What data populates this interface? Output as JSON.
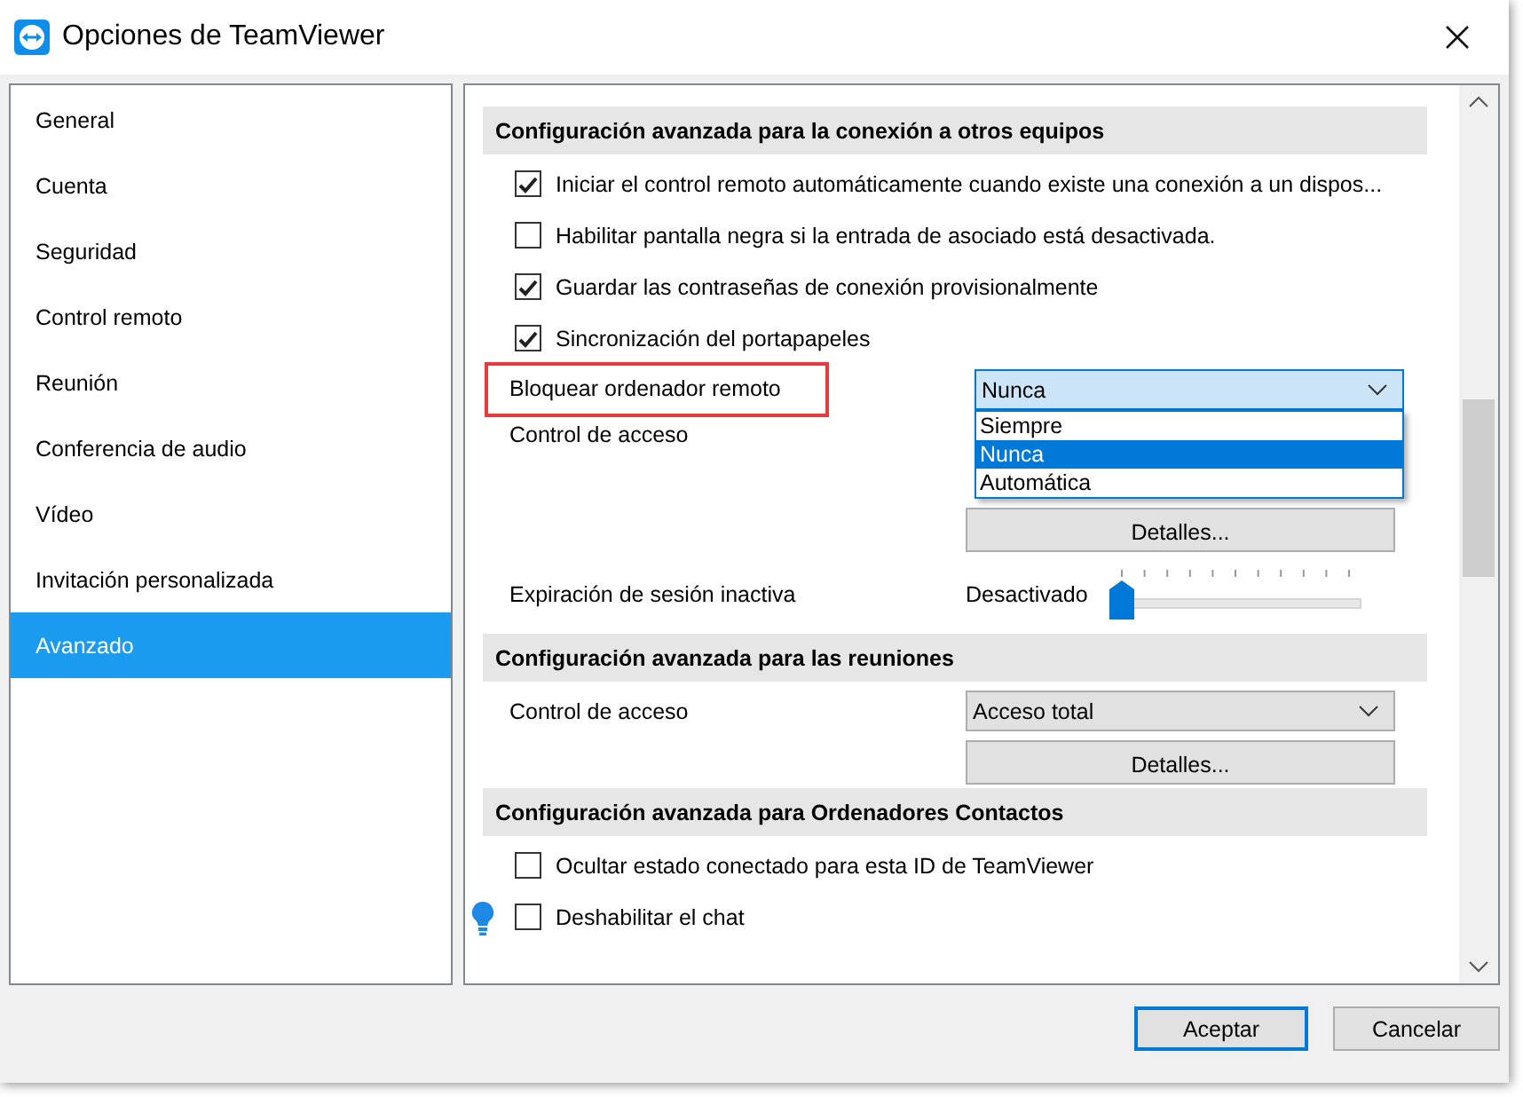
{
  "window": {
    "title": "Opciones de TeamViewer"
  },
  "sidebar": {
    "items": [
      {
        "label": "General",
        "selected": false
      },
      {
        "label": "Cuenta",
        "selected": false
      },
      {
        "label": "Seguridad",
        "selected": false
      },
      {
        "label": "Control remoto",
        "selected": false
      },
      {
        "label": "Reunión",
        "selected": false
      },
      {
        "label": "Conferencia de audio",
        "selected": false
      },
      {
        "label": "Vídeo",
        "selected": false
      },
      {
        "label": "Invitación personalizada",
        "selected": false
      },
      {
        "label": "Avanzado",
        "selected": true
      }
    ]
  },
  "sections": [
    {
      "title": "Configuración avanzada para la conexión a otros equipos",
      "rows": [
        {
          "kind": "checkbox",
          "label": "Iniciar el control remoto automáticamente cuando existe una conexión a un dispos...",
          "checked": true
        },
        {
          "kind": "checkbox",
          "label": "Habilitar pantalla negra si la entrada de asociado está desactivada.",
          "checked": false
        },
        {
          "kind": "checkbox",
          "label": "Guardar las contraseñas de conexión provisionalmente",
          "checked": true
        },
        {
          "kind": "checkbox",
          "label": "Sincronización del portapapeles",
          "checked": true
        },
        {
          "kind": "combo",
          "label": "Bloquear ordenador remoto",
          "value": "Nunca",
          "highlighted": true,
          "open": true,
          "options": [
            {
              "label": "Siempre",
              "selected": false
            },
            {
              "label": "Nunca",
              "selected": true
            },
            {
              "label": "Automática",
              "selected": false
            }
          ]
        },
        {
          "kind": "label",
          "label": "Control de acceso"
        },
        {
          "kind": "button",
          "label": "Detalles..."
        },
        {
          "kind": "slider",
          "label": "Expiración de sesión inactiva",
          "reading": "Desactivado",
          "level": 0
        }
      ]
    },
    {
      "title": "Configuración avanzada para las reuniones",
      "rows": [
        {
          "kind": "combo",
          "label": "Control de acceso",
          "value": "Acceso total",
          "highlighted": false,
          "open": false
        },
        {
          "kind": "button",
          "label": "Detalles..."
        }
      ]
    },
    {
      "title": "Configuración avanzada para Ordenadores  Contactos",
      "rows": [
        {
          "kind": "checkbox",
          "label": "Ocultar estado conectado para esta ID de TeamViewer",
          "checked": false
        },
        {
          "kind": "checkbox",
          "label": "Deshabilitar el chat",
          "checked": false,
          "tip": true
        }
      ]
    }
  ],
  "buttons": [
    {
      "label": "Aceptar",
      "default": true
    },
    {
      "label": "Cancelar",
      "default": false
    }
  ]
}
